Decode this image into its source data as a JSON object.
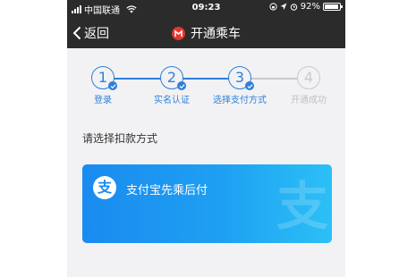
{
  "status_bar": {
    "carrier": "中国联通",
    "time": "09:23",
    "battery": "92%",
    "battery_level": 0.92,
    "icons": [
      "signal-icon",
      "wifi-icon",
      "lock-rotation-icon",
      "location-icon",
      "alarm-icon",
      "battery-icon"
    ]
  },
  "nav": {
    "back_label": "返回",
    "title": "开通乘车",
    "logo_icon": "metro-logo-icon"
  },
  "steps": [
    {
      "number": "1",
      "label": "登录",
      "done": true
    },
    {
      "number": "2",
      "label": "实名认证",
      "done": true
    },
    {
      "number": "3",
      "label": "选择支付方式",
      "done": true
    },
    {
      "number": "4",
      "label": "开通成功",
      "done": false
    }
  ],
  "section": {
    "prompt": "请选择扣款方式"
  },
  "payment": {
    "logo_char": "支",
    "label": "支付宝先乘后付",
    "watermark_char": "支"
  },
  "colors": {
    "accent": "#2f7fd8",
    "inactive": "#c9c9cf",
    "header_bg": "#2b2b2b",
    "card_start": "#1a8bf0",
    "card_end": "#2cc0f6",
    "metro_red": "#e5362c"
  }
}
